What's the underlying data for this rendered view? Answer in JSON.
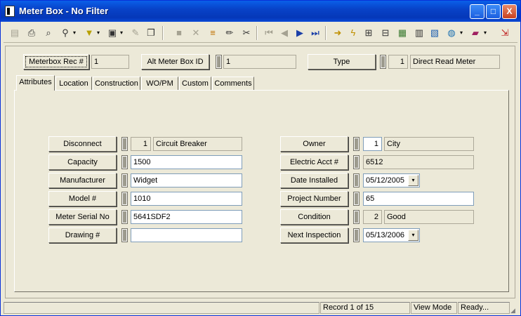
{
  "window": {
    "title": "Meter Box - No Filter",
    "min": "_",
    "max": "□",
    "close": "X"
  },
  "header": {
    "rec_label": "Meterbox Rec #",
    "rec_value": "1",
    "alt_label": "Alt Meter Box ID",
    "alt_value": "1",
    "type_label": "Type",
    "type_code": "1",
    "type_value": "Direct Read Meter"
  },
  "tabs": [
    "Attributes",
    "Location",
    "Construction",
    "WO/PM",
    "Custom",
    "Comments"
  ],
  "left": {
    "disconnect_label": "Disconnect",
    "disconnect_code": "1",
    "disconnect_value": "Circuit Breaker",
    "capacity_label": "Capacity",
    "capacity_value": "1500",
    "manufacturer_label": "Manufacturer",
    "manufacturer_value": "Widget",
    "model_label": "Model #",
    "model_value": "1010",
    "serial_label": "Meter Serial No",
    "serial_value": "5641SDF2",
    "drawing_label": "Drawing #",
    "drawing_value": ""
  },
  "right": {
    "owner_label": "Owner",
    "owner_code": "1",
    "owner_value": "City",
    "electric_label": "Electric Acct #",
    "electric_value": "6512",
    "date_label": "Date Installed",
    "date_value": "05/12/2005",
    "project_label": "Project Number",
    "project_value": "65",
    "condition_label": "Condition",
    "condition_code": "2",
    "condition_value": "Good",
    "next_label": "Next Inspection",
    "next_value": "05/13/2006"
  },
  "status": {
    "record": "Record 1 of 15",
    "mode": "View Mode",
    "ready": "Ready..."
  },
  "toolbar": {
    "dropdown": "▾"
  }
}
